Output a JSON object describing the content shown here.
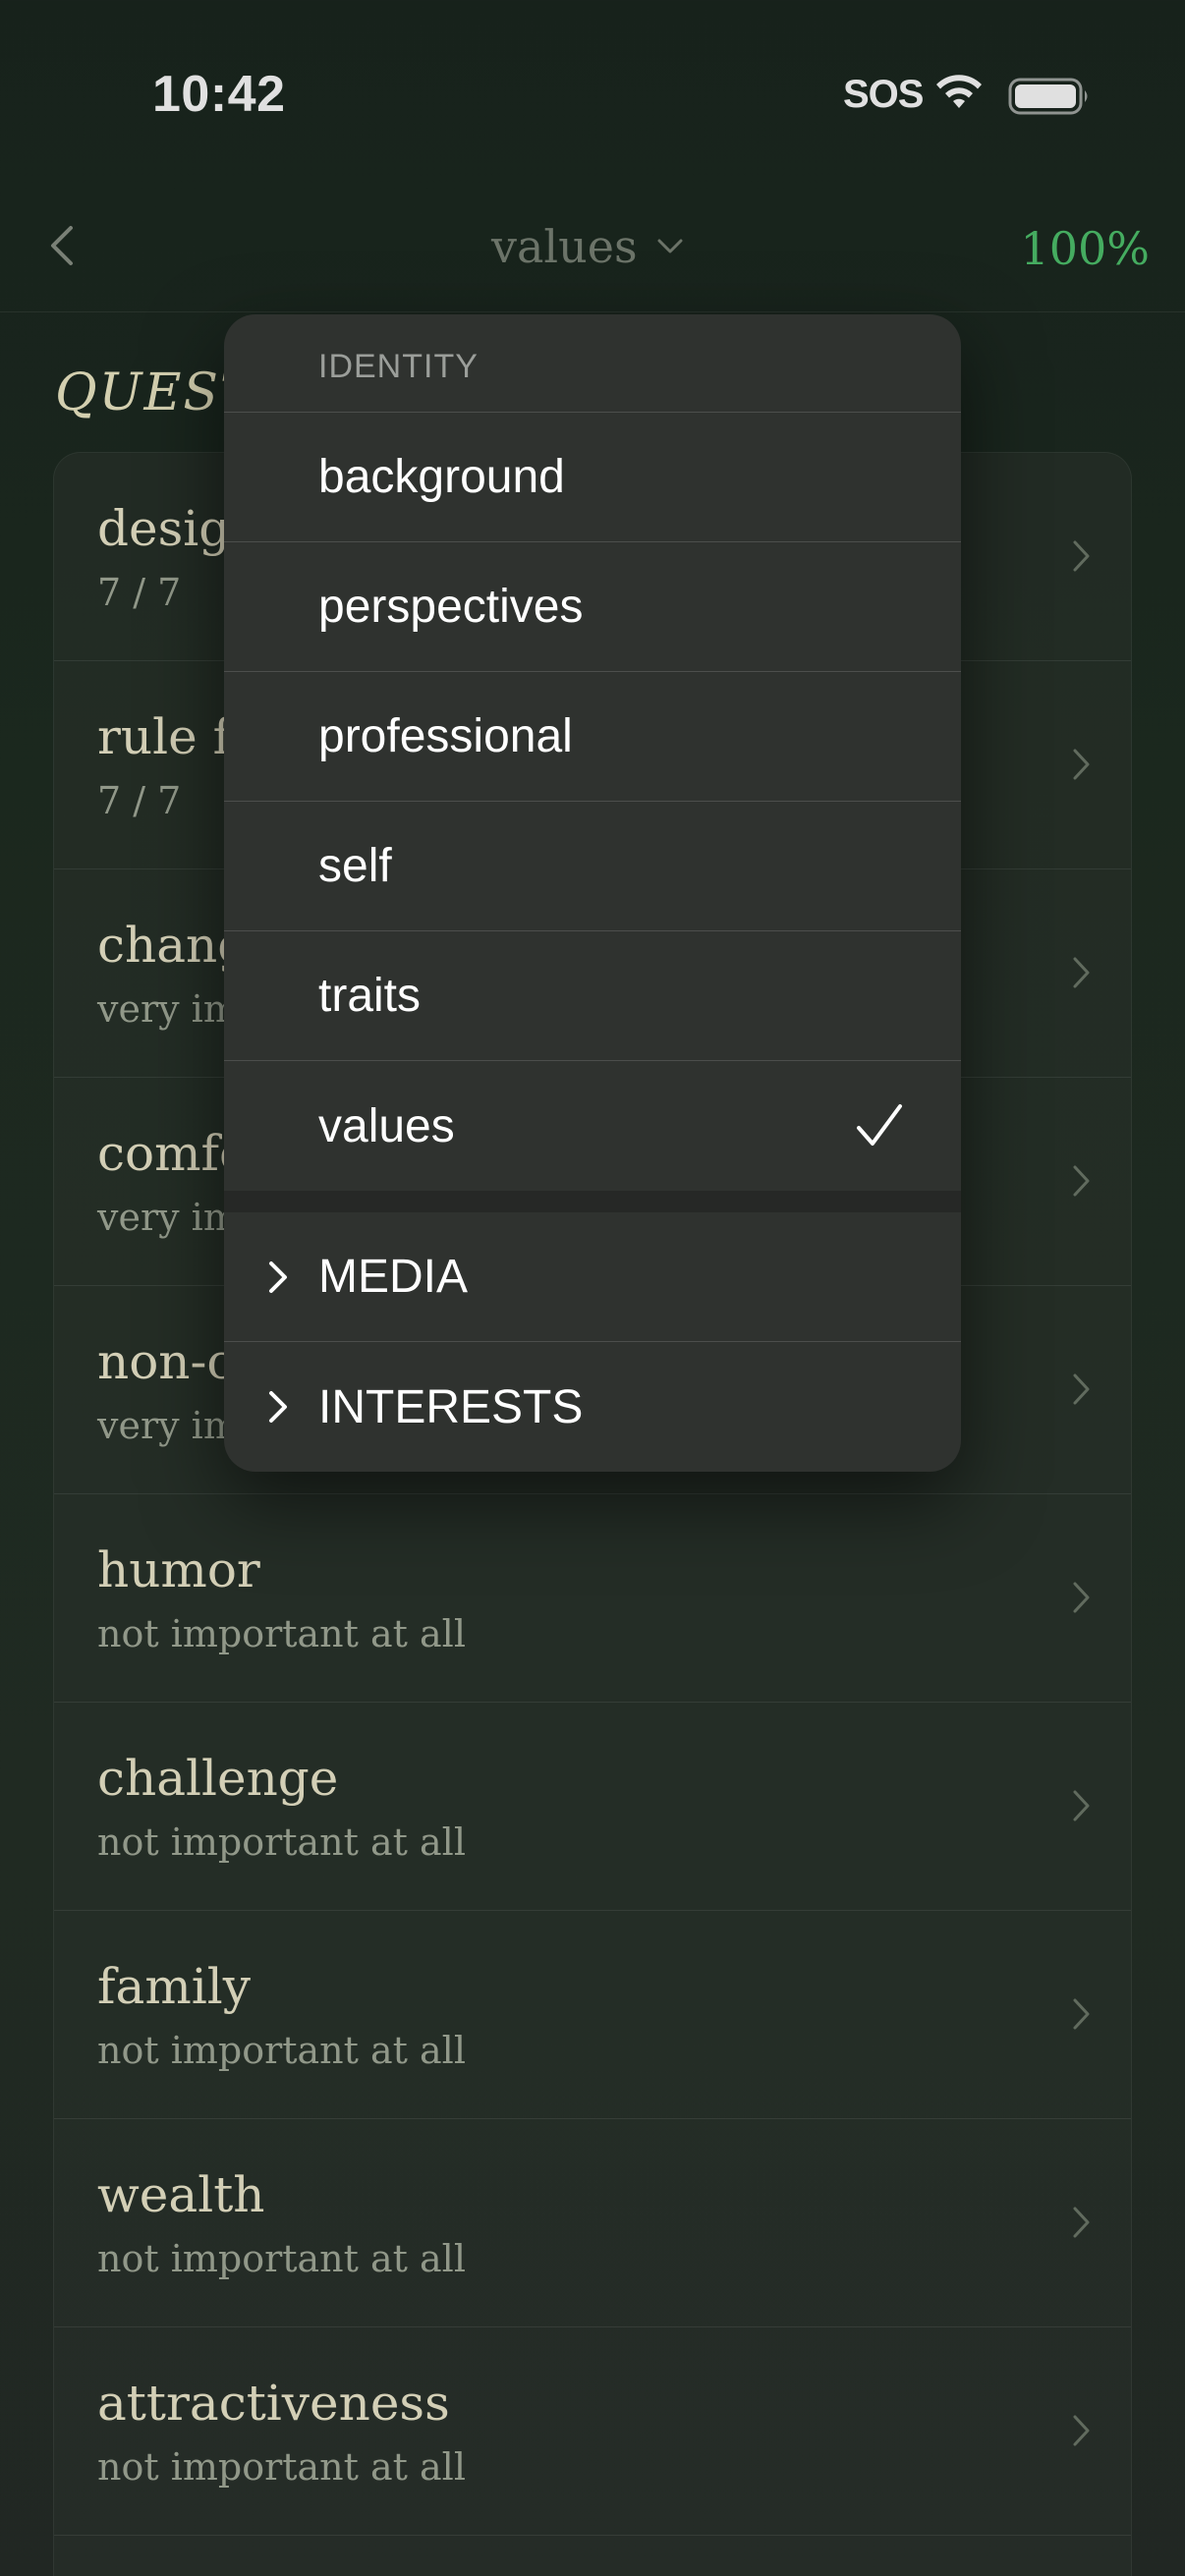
{
  "status_bar": {
    "time": "10:42",
    "sos": "SOS",
    "wifi_icon": "wifi-icon",
    "battery_icon": "battery-icon"
  },
  "nav": {
    "back_icon": "chevron-left-icon",
    "title": "values",
    "title_chevron_icon": "chevron-down-icon",
    "progress": "100%"
  },
  "section": {
    "title": "QUESTIONS"
  },
  "rows": [
    {
      "title": "design",
      "subtitle": "7 / 7"
    },
    {
      "title": "rule following",
      "subtitle": "7 / 7"
    },
    {
      "title": "change",
      "subtitle": "very important"
    },
    {
      "title": "comfort",
      "subtitle": "very important"
    },
    {
      "title": "non-conformity",
      "subtitle": "very important"
    },
    {
      "title": "humor",
      "subtitle": "not important at all"
    },
    {
      "title": "challenge",
      "subtitle": "not important at all"
    },
    {
      "title": "family",
      "subtitle": "not important at all"
    },
    {
      "title": "wealth",
      "subtitle": "not important at all"
    },
    {
      "title": "attractiveness",
      "subtitle": "not important at all"
    }
  ],
  "menu": {
    "header": "IDENTITY",
    "items": [
      {
        "label": "background",
        "selected": false
      },
      {
        "label": "perspectives",
        "selected": false
      },
      {
        "label": "professional",
        "selected": false
      },
      {
        "label": "self",
        "selected": false
      },
      {
        "label": "traits",
        "selected": false
      },
      {
        "label": "values",
        "selected": true
      }
    ],
    "groups": [
      {
        "label": "MEDIA",
        "icon": "chevron-right-icon"
      },
      {
        "label": "INTERESTS",
        "icon": "chevron-right-icon"
      }
    ]
  },
  "colors": {
    "accent_green": "#4fc46e",
    "text_cream": "#f1ecd0",
    "menu_bg": "#2f322f"
  }
}
